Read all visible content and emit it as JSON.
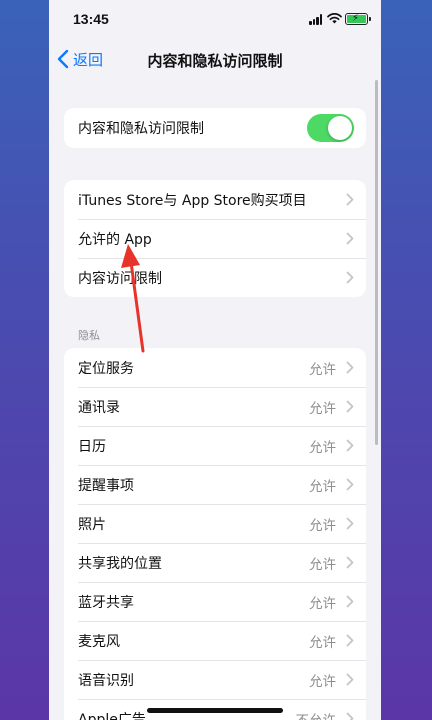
{
  "status_bar": {
    "time": "13:45"
  },
  "nav": {
    "back_label": "返回",
    "title": "内容和隐私访问限制"
  },
  "toggle_row": {
    "label": "内容和隐私访问限制",
    "on": true
  },
  "group1": [
    {
      "label": "iTunes Store与 App Store购买项目"
    },
    {
      "label": "允许的 App"
    },
    {
      "label": "内容访问限制"
    }
  ],
  "privacy": {
    "header": "隐私",
    "items": [
      {
        "label": "定位服务",
        "value": "允许"
      },
      {
        "label": "通讯录",
        "value": "允许"
      },
      {
        "label": "日历",
        "value": "允许"
      },
      {
        "label": "提醒事项",
        "value": "允许"
      },
      {
        "label": "照片",
        "value": "允许"
      },
      {
        "label": "共享我的位置",
        "value": "允许"
      },
      {
        "label": "蓝牙共享",
        "value": "允许"
      },
      {
        "label": "麦克风",
        "value": "允许"
      },
      {
        "label": "语音识别",
        "value": "允许"
      },
      {
        "label": "Apple广告",
        "value": "不允许"
      }
    ]
  },
  "colors": {
    "accent": "#0a7aff",
    "toggle_on": "#4cd964",
    "annotation_arrow": "#e8332a"
  }
}
